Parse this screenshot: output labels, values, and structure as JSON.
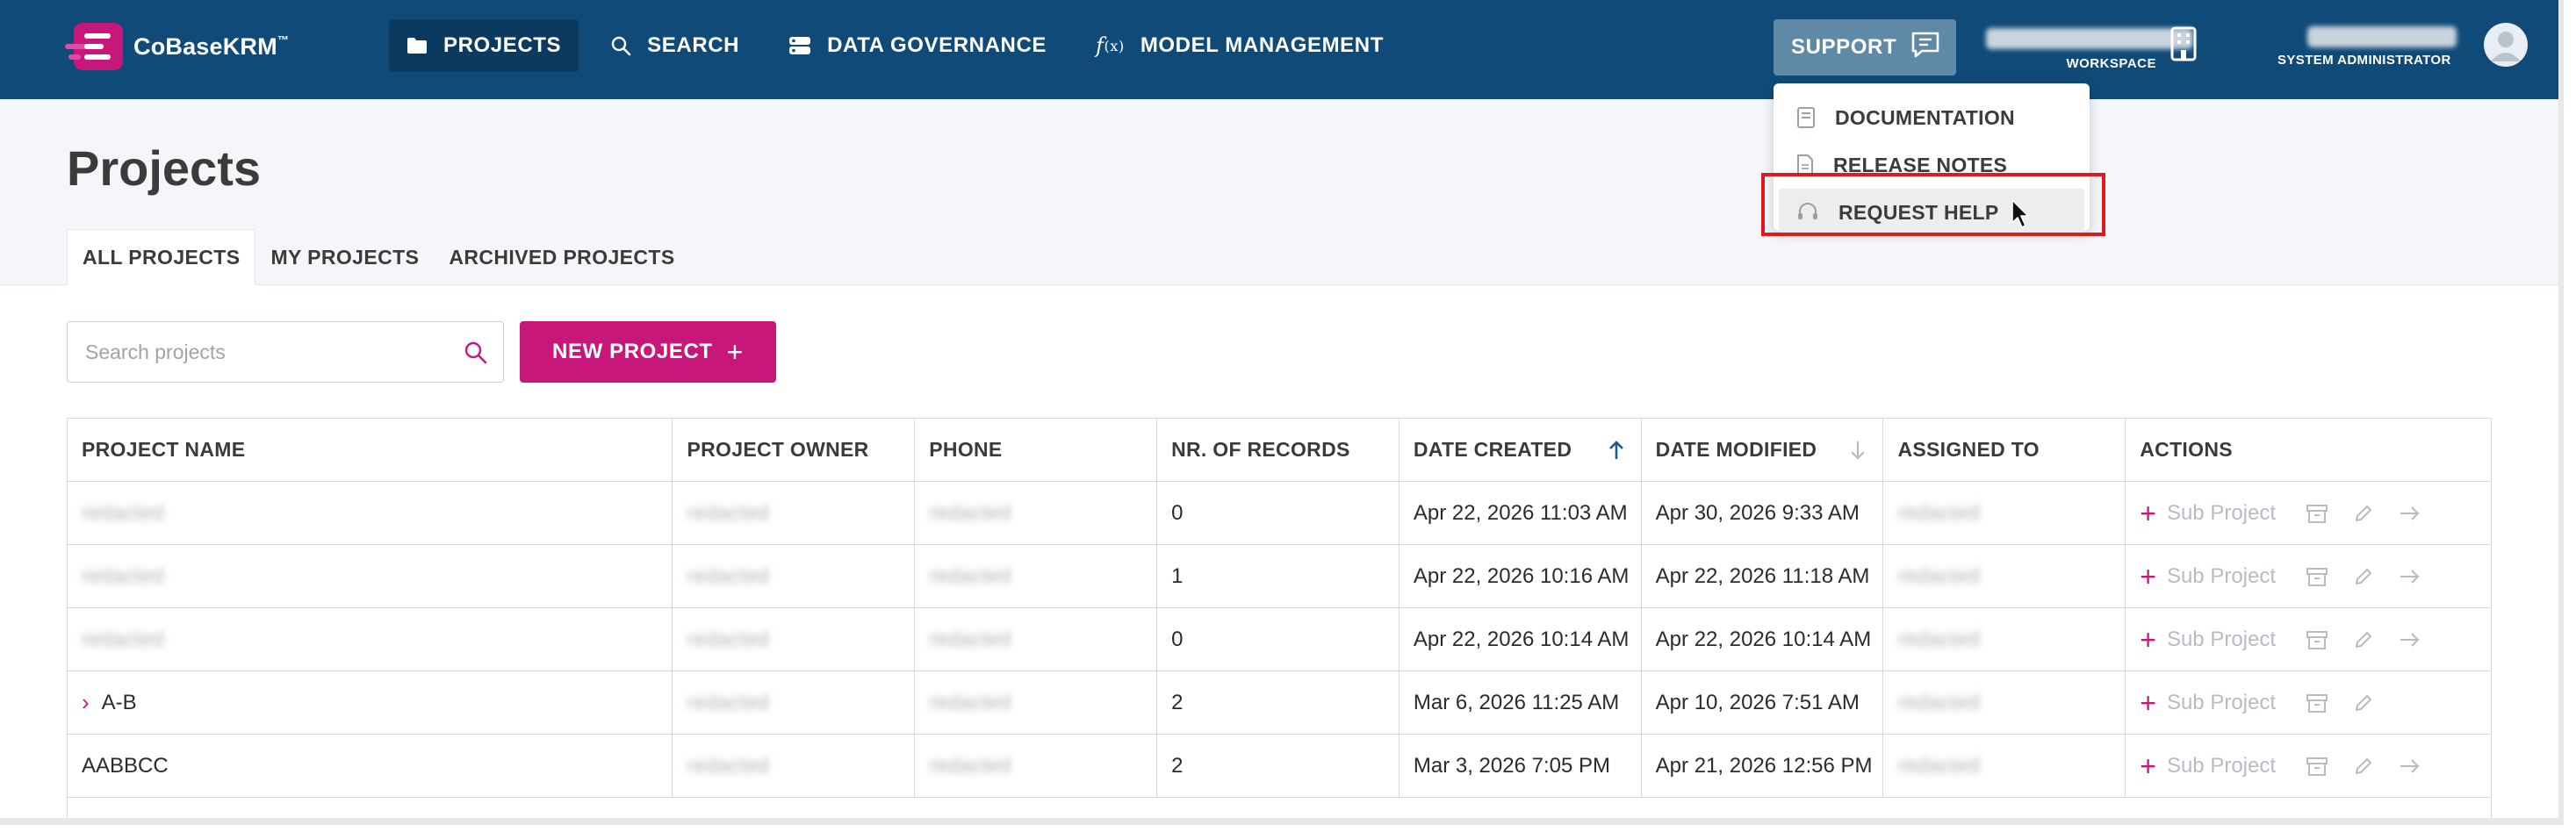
{
  "app": {
    "name": "CoBaseKRM",
    "trademark": "™"
  },
  "nav": {
    "items": [
      {
        "label": "PROJECTS",
        "icon": "folder-icon",
        "active": true
      },
      {
        "label": "SEARCH",
        "icon": "search-icon",
        "active": false
      },
      {
        "label": "DATA GOVERNANCE",
        "icon": "database-icon",
        "active": false
      },
      {
        "label": "MODEL MANAGEMENT",
        "icon": "function-icon",
        "active": false
      }
    ]
  },
  "support": {
    "label": "SUPPORT",
    "menu": [
      {
        "label": "DOCUMENTATION",
        "icon": "book-icon"
      },
      {
        "label": "RELEASE NOTES",
        "icon": "document-icon"
      },
      {
        "label": "REQUEST HELP",
        "icon": "headset-icon",
        "hovered": true
      }
    ]
  },
  "workspace": {
    "label": "WORKSPACE",
    "name_redacted": true
  },
  "user": {
    "role": "SYSTEM ADMINISTRATOR",
    "name_redacted": true
  },
  "page": {
    "title": "Projects",
    "tabs": [
      {
        "label": "ALL PROJECTS",
        "active": true
      },
      {
        "label": "MY PROJECTS",
        "active": false
      },
      {
        "label": "ARCHIVED PROJECTS",
        "active": false
      }
    ]
  },
  "search": {
    "placeholder": "Search projects",
    "value": ""
  },
  "new_project": {
    "label": "NEW PROJECT",
    "icon": "plus-icon"
  },
  "table": {
    "columns": [
      "PROJECT NAME",
      "PROJECT OWNER",
      "PHONE",
      "NR. OF RECORDS",
      "DATE CREATED",
      "DATE MODIFIED",
      "ASSIGNED TO",
      "ACTIONS"
    ],
    "sort": {
      "column": "DATE CREATED",
      "direction": "ascending"
    },
    "sub_project_label": "Sub Project",
    "rows": [
      {
        "name": "redacted",
        "name_redacted": true,
        "expandable": false,
        "owner": "redacted",
        "phone": "redacted",
        "records": "0",
        "created": "Apr 22, 2026 11:03 AM",
        "modified": "Apr 30, 2026 9:33 AM",
        "assigned": "redacted",
        "has_navigate": true
      },
      {
        "name": "redacted",
        "name_redacted": true,
        "expandable": false,
        "owner": "redacted",
        "phone": "redacted",
        "records": "1",
        "created": "Apr 22, 2026 10:16 AM",
        "modified": "Apr 22, 2026 11:18 AM",
        "assigned": "redacted",
        "has_navigate": true
      },
      {
        "name": "redacted",
        "name_redacted": true,
        "expandable": false,
        "owner": "redacted",
        "phone": "redacted",
        "records": "0",
        "created": "Apr 22, 2026 10:14 AM",
        "modified": "Apr 22, 2026 10:14 AM",
        "assigned": "redacted",
        "has_navigate": true
      },
      {
        "name": "A-B",
        "name_redacted": false,
        "expandable": true,
        "owner": "redacted",
        "phone": "redacted",
        "records": "2",
        "created": "Mar 6, 2026 11:25 AM",
        "modified": "Apr 10, 2026 7:51 AM",
        "assigned": "redacted",
        "has_navigate": false
      },
      {
        "name": "AABBCC",
        "name_redacted": false,
        "expandable": false,
        "owner": "redacted",
        "phone": "redacted",
        "records": "2",
        "created": "Mar 3, 2026 7:05 PM",
        "modified": "Apr 21, 2026 12:56 PM",
        "assigned": "redacted",
        "has_navigate": true
      }
    ]
  },
  "colors": {
    "topbar": "#0f4a78",
    "brand_magenta": "#c8177a",
    "highlight_red": "#e0191c"
  }
}
